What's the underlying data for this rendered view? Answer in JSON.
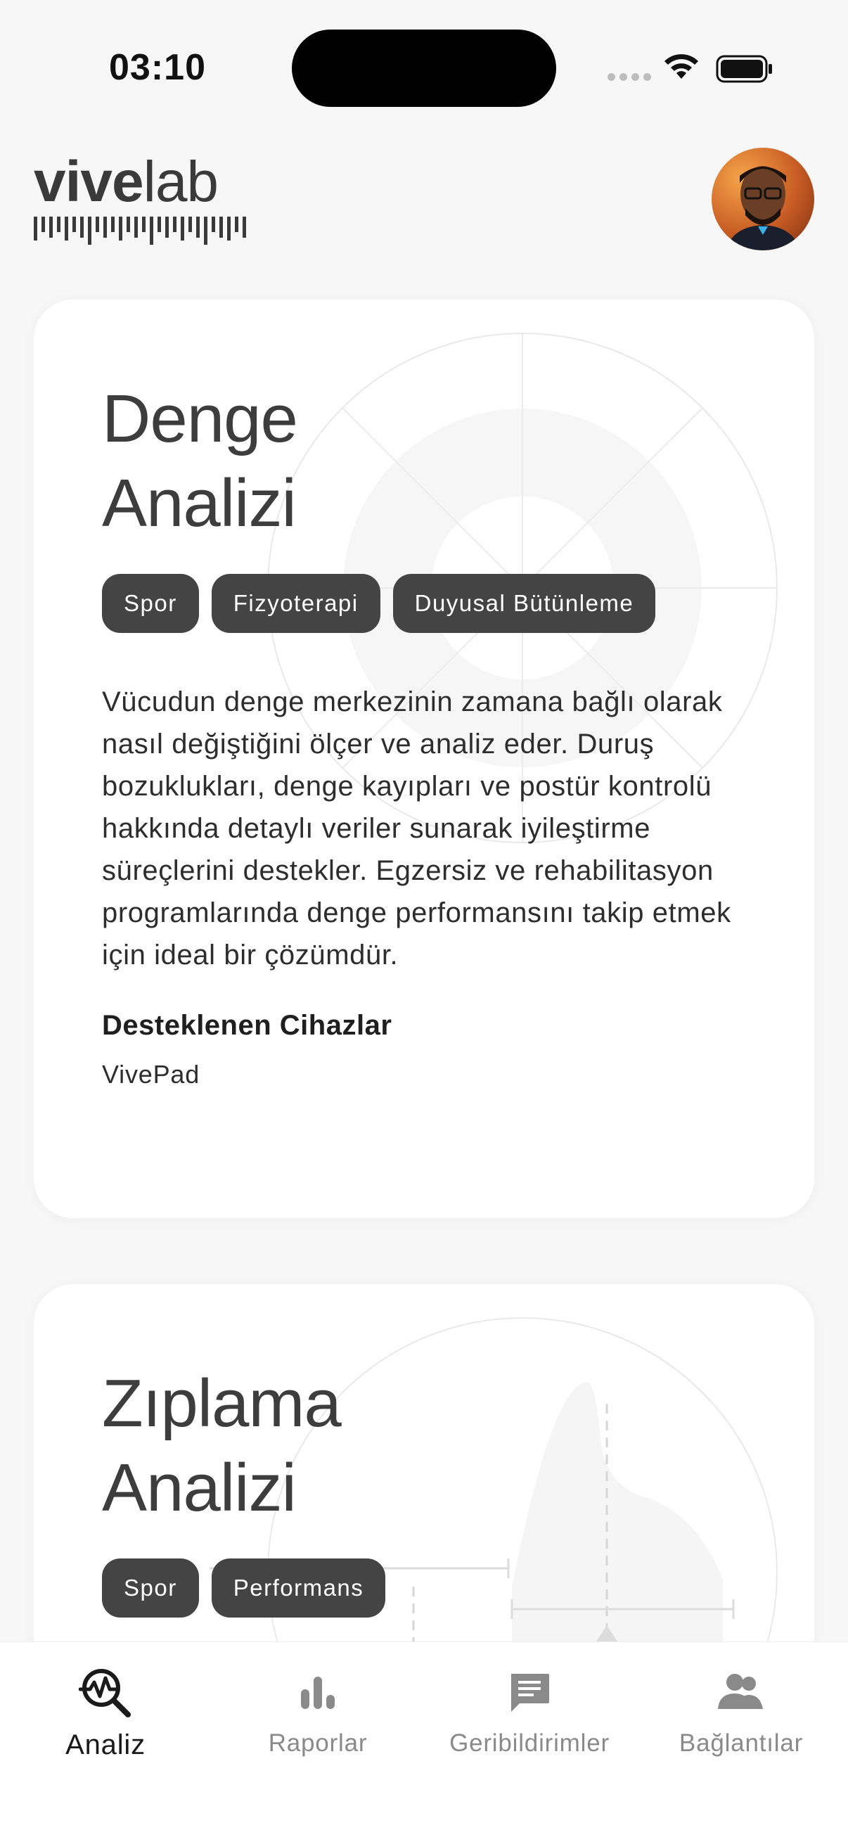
{
  "status_bar": {
    "time": "03:10"
  },
  "header": {
    "logo_bold": "vive",
    "logo_light": "lab"
  },
  "cards": [
    {
      "title_line1": "Denge",
      "title_line2": "Analizi",
      "tags": [
        "Spor",
        "Fizyoterapi",
        "Duyusal Bütünleme"
      ],
      "description": "Vücudun denge merkezinin zamana bağlı olarak nasıl değiştiğini ölçer ve analiz eder. Duruş bozuklukları, denge kayıpları ve postür kontrolü hakkında detaylı veriler sunarak iyileştirme süreçlerini destekler. Egzersiz ve rehabilitasyon programlarında denge performansını takip etmek için ideal bir çözümdür.",
      "supported_title": "Desteklenen Cihazlar",
      "supported_device": "VivePad"
    },
    {
      "title_line1": "Zıplama",
      "title_line2": "Analizi",
      "tags": [
        "Spor",
        "Performans"
      ]
    }
  ],
  "nav": {
    "items": [
      {
        "label": "Analiz",
        "icon": "analysis-search-icon",
        "active": true
      },
      {
        "label": "Raporlar",
        "icon": "bar-chart-icon",
        "active": false
      },
      {
        "label": "Geribildirimler",
        "icon": "feedback-icon",
        "active": false
      },
      {
        "label": "Bağlantılar",
        "icon": "people-icon",
        "active": false
      }
    ]
  },
  "colors": {
    "background": "#f7f7f7",
    "card": "#ffffff",
    "tag": "#444444",
    "text": "#2b2b2b",
    "nav_inactive": "#8a8a8a"
  }
}
